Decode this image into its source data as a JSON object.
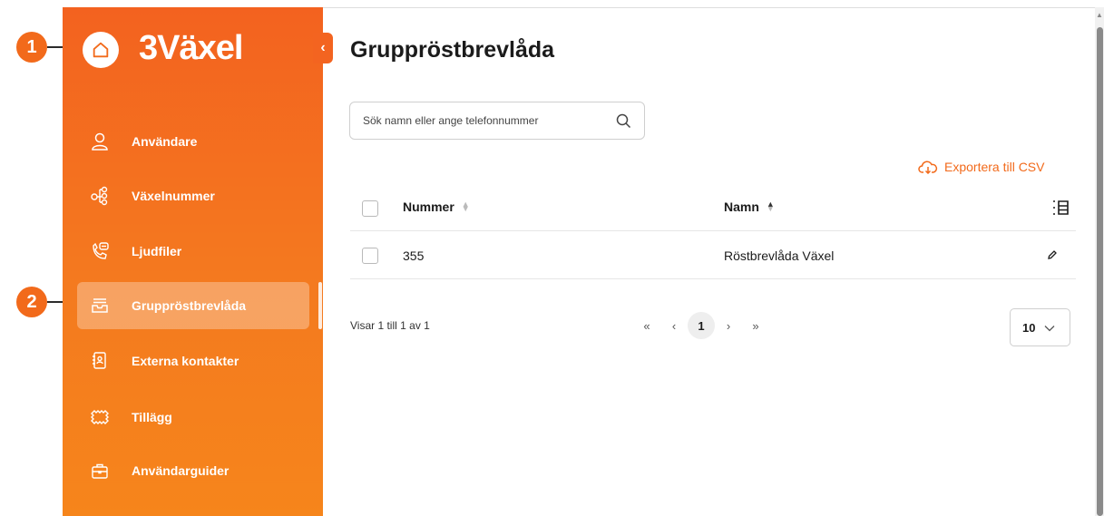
{
  "app": {
    "logo_text": "3Växel"
  },
  "callouts": [
    "1",
    "2"
  ],
  "sidebar": {
    "items": [
      {
        "label": "Användare",
        "icon": "user-icon"
      },
      {
        "label": "Växelnummer",
        "icon": "org-chart-icon"
      },
      {
        "label": "Ljudfiler",
        "icon": "phone-audio-icon"
      },
      {
        "label": "Gruppröstbrevlåda",
        "icon": "voicemail-inbox-icon",
        "active": true
      },
      {
        "label": "Externa kontakter",
        "icon": "contact-book-icon"
      },
      {
        "label": "Tillägg",
        "icon": "ticket-icon"
      },
      {
        "label": "Användarguider",
        "icon": "briefcase-icon"
      }
    ]
  },
  "page": {
    "title": "Gruppröstbrevlåda"
  },
  "search": {
    "placeholder": "Sök namn eller ange telefonnummer"
  },
  "export": {
    "label": "Exportera till CSV"
  },
  "table": {
    "columns": [
      "Nummer",
      "Namn"
    ],
    "rows": [
      {
        "nummer": "355",
        "namn": "Röstbrevlåda Växel"
      }
    ]
  },
  "pagination": {
    "summary": "Visar 1 till 1 av 1",
    "first": "«",
    "prev": "‹",
    "current_page": "1",
    "next": "›",
    "last": "»",
    "page_size": "10"
  },
  "colors": {
    "accent": "#f26a1b",
    "sidebar_top": "#f3621f",
    "sidebar_bottom": "#f6851b"
  }
}
